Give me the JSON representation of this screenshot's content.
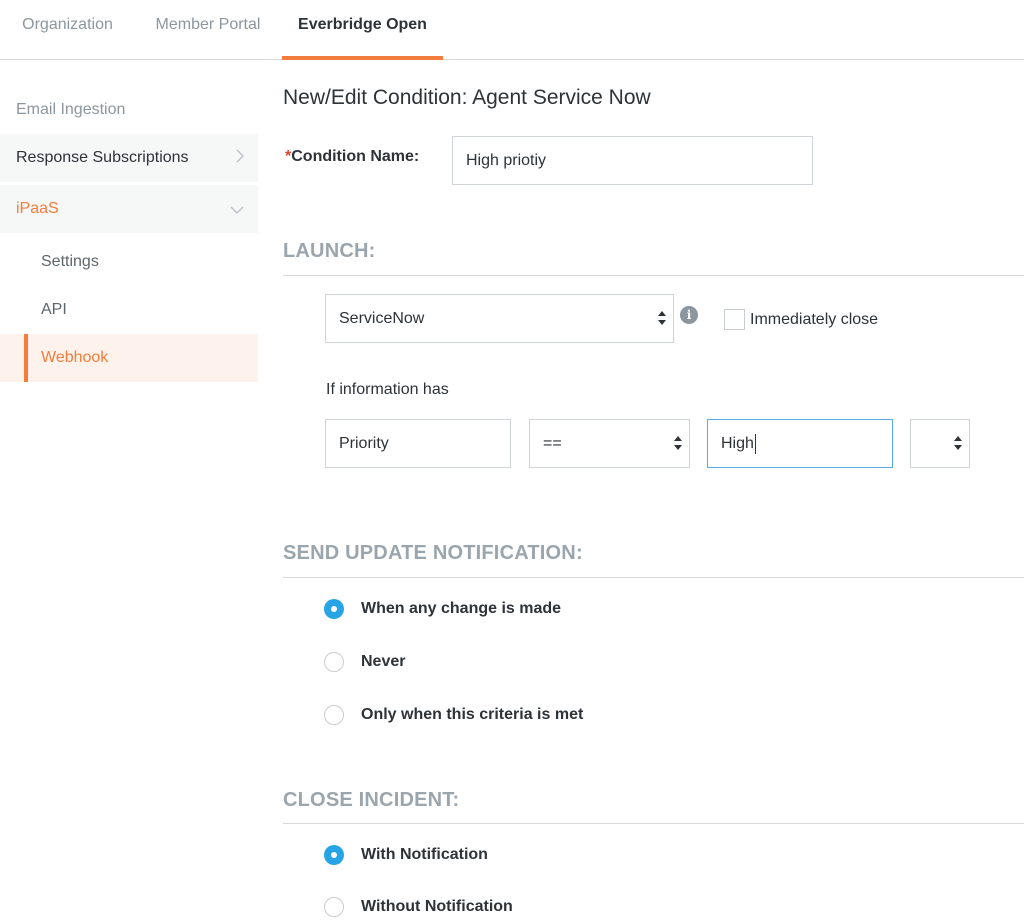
{
  "topnav": {
    "tabs": [
      {
        "label": "Organization"
      },
      {
        "label": "Member Portal"
      },
      {
        "label": "Everbridge Open"
      }
    ]
  },
  "sidebar": {
    "items": [
      {
        "label": "Email Ingestion"
      },
      {
        "label": "Response Subscriptions"
      },
      {
        "label": "iPaaS"
      },
      {
        "label": "Settings"
      },
      {
        "label": "API"
      },
      {
        "label": "Webhook"
      }
    ]
  },
  "colors": {
    "accent": "#f47c3c",
    "radio_selected": "#27a4e6",
    "required": "#e0452d"
  },
  "form": {
    "title": "New/Edit Condition: Agent Service Now",
    "required_mark": "*",
    "condition_name_label": "Condition Name:",
    "condition_name_value": "High priotiy",
    "launch": {
      "heading": "LAUNCH:",
      "service_select": "ServiceNow",
      "immediately_close_label": "Immediately close",
      "immediately_close_checked": false,
      "if_info_label": "If information has",
      "field_value": "Priority",
      "operator_select": "==",
      "match_value": "High",
      "extra_select": ""
    },
    "send_update": {
      "heading": "SEND UPDATE NOTIFICATION:",
      "options": [
        {
          "label": "When any change is made",
          "selected": true
        },
        {
          "label": "Never",
          "selected": false
        },
        {
          "label": "Only when this criteria is met",
          "selected": false
        }
      ]
    },
    "close_incident": {
      "heading": "CLOSE INCIDENT:",
      "options": [
        {
          "label": "With Notification",
          "selected": true
        },
        {
          "label": "Without Notification",
          "selected": false
        }
      ]
    }
  }
}
